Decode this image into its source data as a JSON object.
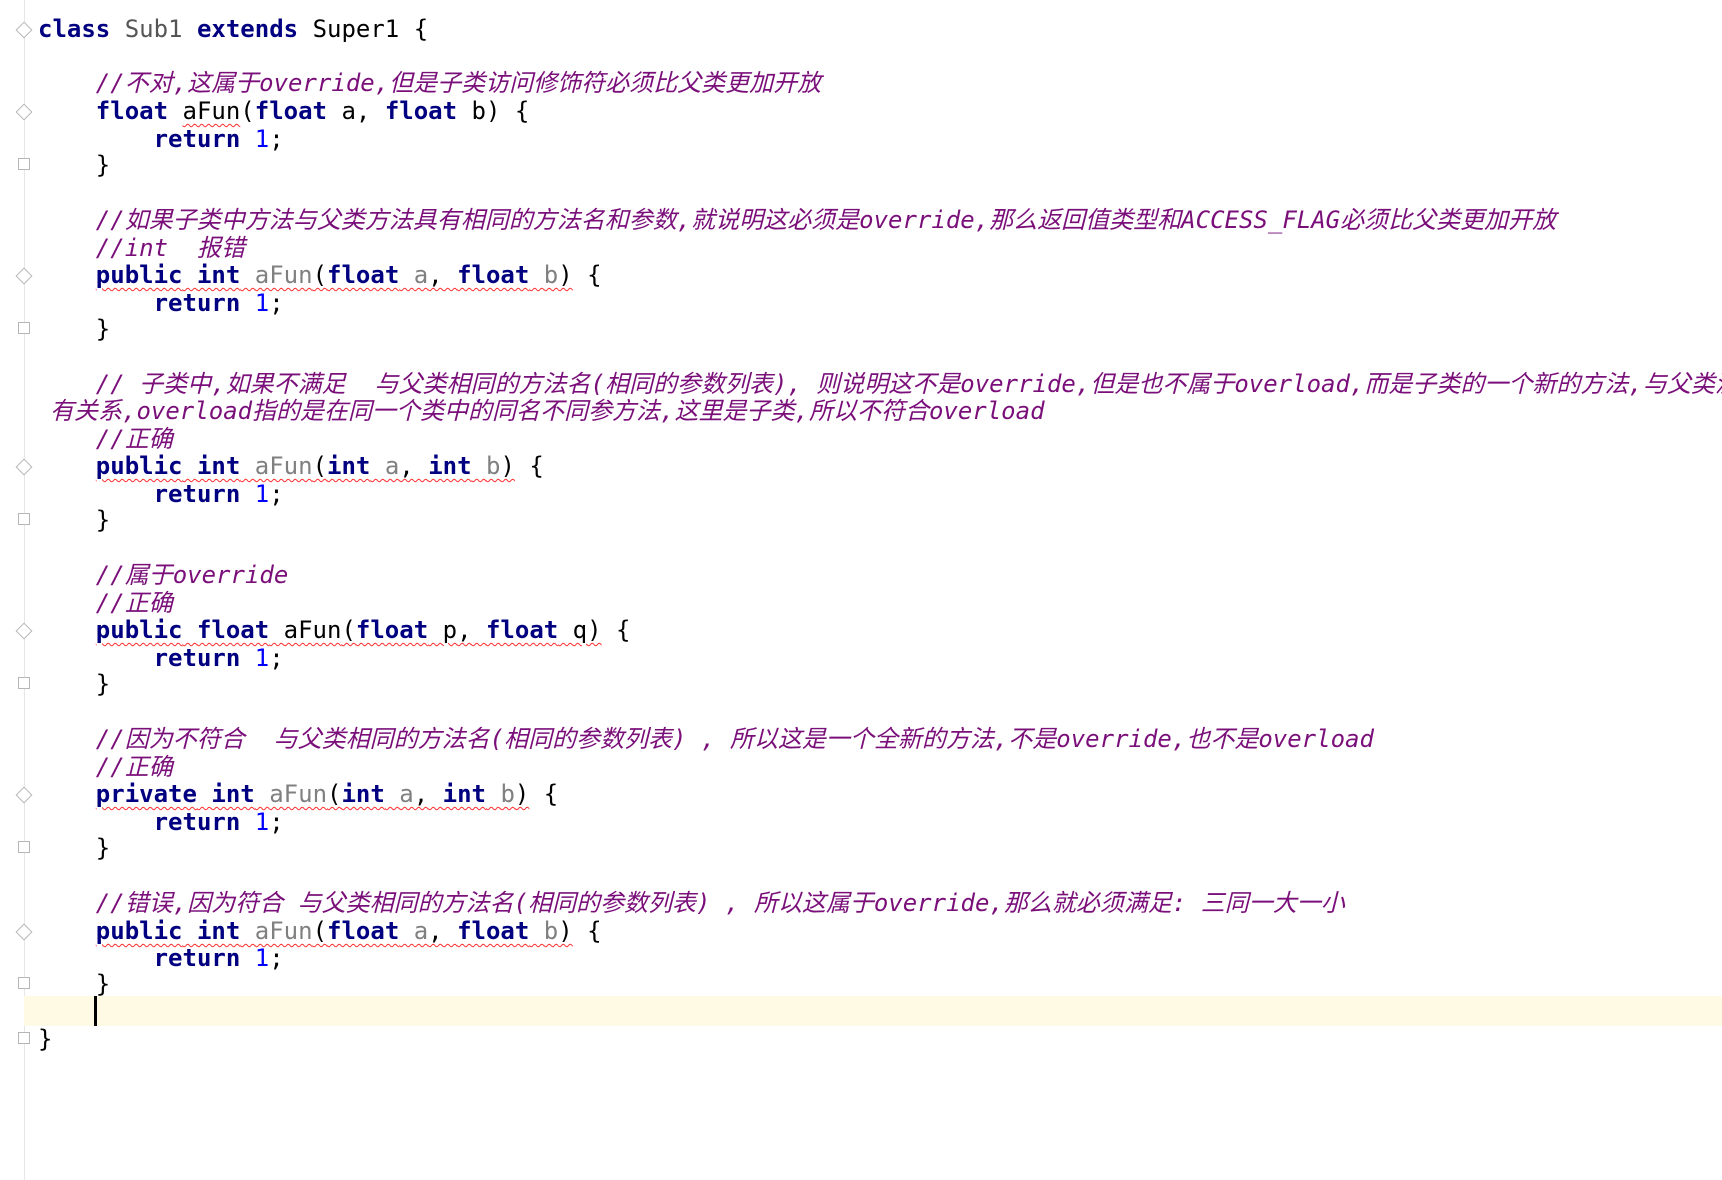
{
  "editor": {
    "class_decl": {
      "kw_class": "class",
      "name": "Sub1",
      "kw_extends": "extends",
      "super": "Super1",
      "brace": " {"
    },
    "comments": {
      "c1": "//不对,这属于override,但是子类访问修饰符必须比父类更加开放",
      "c2": "//如果子类中方法与父类方法具有相同的方法名和参数,就说明这必须是override,那么返回值类型和ACCESS_FLAG必须比父类更加开放",
      "c3": "//int  报错",
      "c4a": "// 子类中,如果不满足  与父类相同的方法名(相同的参数列表), 则说明这不是override,但是也不属于overload,而是子类的一个新的方法,与父类没",
      "c4b": "有关系,overload指的是在同一个类中的同名不同参方法,这里是子类,所以不符合overload",
      "c5": "//正确",
      "c6": "//属于override",
      "c7": "//正确",
      "c8": "//因为不符合  与父类相同的方法名(相同的参数列表) , 所以这是一个全新的方法,不是override,也不是overload",
      "c9": "//正确",
      "c10": "//错误,因为符合 与父类相同的方法名(相同的参数列表) , 所以这属于override,那么就必须满足: 三同一大一小"
    },
    "tokens": {
      "kw_float": "float",
      "kw_public": "public",
      "kw_int": "int",
      "kw_private": "private",
      "kw_return": "return",
      "aFun": "aFun",
      "num1": "1",
      "semicolon": ";",
      "pa": "a",
      "pb": "b",
      "pp": "p",
      "pq": "q",
      "open_paren": "(",
      "close_paren": ")",
      "comma": ",",
      "space": " ",
      "brace_open": " {",
      "brace_close": "}"
    },
    "colors": {
      "keyword": "#000080",
      "number": "#0000ff",
      "comment": "#7a0f7a",
      "unused": "#808080",
      "error_underline": "#ff2b2b",
      "current_line": "#fffae3"
    }
  }
}
